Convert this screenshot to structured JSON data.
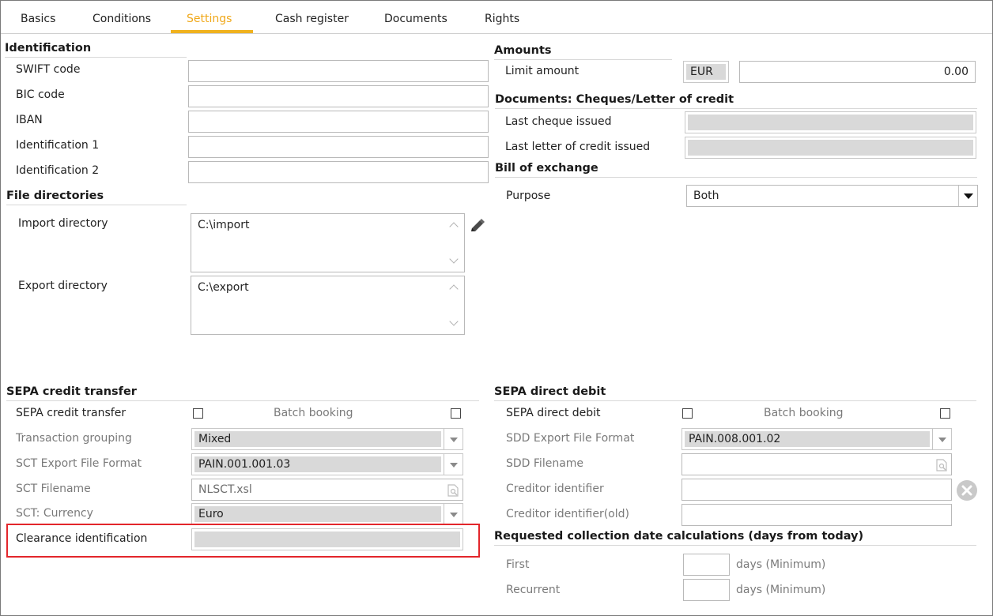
{
  "tabs": [
    {
      "label": "Basics"
    },
    {
      "label": "Conditions"
    },
    {
      "label": "Settings",
      "active": true
    },
    {
      "label": "Cash register"
    },
    {
      "label": "Documents"
    },
    {
      "label": "Rights"
    }
  ],
  "identification": {
    "title": "Identification",
    "fields": [
      {
        "label": "SWIFT code",
        "value": ""
      },
      {
        "label": "BIC code",
        "value": ""
      },
      {
        "label": "IBAN",
        "value": ""
      },
      {
        "label": "Identification 1",
        "value": ""
      },
      {
        "label": "Identification 2",
        "value": ""
      }
    ]
  },
  "file_directories": {
    "title": "File directories",
    "import_label": "Import directory",
    "import_value": "C:\\import",
    "export_label": "Export directory",
    "export_value": "C:\\export"
  },
  "amounts": {
    "title": "Amounts",
    "limit_label": "Limit amount",
    "currency": "EUR",
    "limit_value": "0.00"
  },
  "documents": {
    "title": "Documents: Cheques/Letter of credit",
    "last_cheque_label": "Last cheque issued",
    "last_letter_label": "Last letter of credit issued"
  },
  "bill": {
    "title": "Bill of exchange",
    "purpose_label": "Purpose",
    "purpose_value": "Both"
  },
  "sct": {
    "title": "SEPA credit transfer",
    "checkbox_label": "SEPA credit transfer",
    "batch_label": "Batch booking",
    "grouping_label": "Transaction grouping",
    "grouping_value": "Mixed",
    "format_label": "SCT Export File Format",
    "format_value": "PAIN.001.001.03",
    "filename_label": "SCT Filename",
    "filename_value": "NLSCT.xsl",
    "currency_label": "SCT: Currency",
    "currency_value": "Euro",
    "clearance_label": "Clearance identification"
  },
  "sdd": {
    "title": "SEPA direct debit",
    "checkbox_label": "SEPA direct debit",
    "batch_label": "Batch booking",
    "format_label": "SDD Export File Format",
    "format_value": "PAIN.008.001.02",
    "filename_label": "SDD Filename",
    "creditor_label": "Creditor identifier",
    "creditor_old_label": "Creditor identifier(old)"
  },
  "collection": {
    "title": "Requested collection date calculations (days from today)",
    "first_label": "First",
    "recurrent_label": "Recurrent",
    "days_min": "days (Minimum)"
  },
  "colors": {
    "active_tab": "#f0a81a",
    "highlight": "#e3262b"
  }
}
